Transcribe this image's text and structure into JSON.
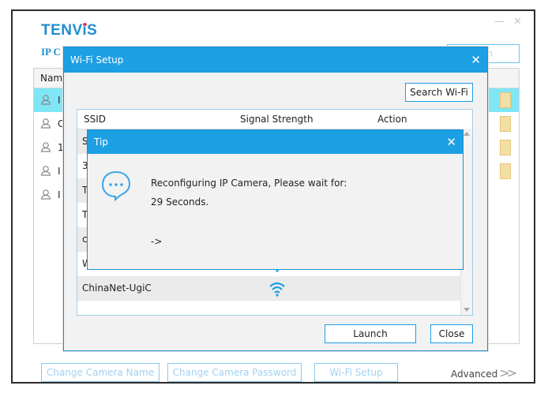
{
  "main_window": {
    "logo": "TENViS",
    "subtitle": "IP C",
    "fresh_label": "sh",
    "minimize_glyph": "—",
    "close_glyph": "✕",
    "list_header": "Nam",
    "rows": [
      {
        "label": "I",
        "selected": true
      },
      {
        "label": "C",
        "selected": false
      },
      {
        "label": "1",
        "selected": false
      },
      {
        "label": "I",
        "selected": false
      },
      {
        "label": "I",
        "selected": false
      }
    ],
    "buttons": {
      "change_name": "Change Camera Name",
      "change_password": "Change Camera Password",
      "wifi_setup": "Wi-Fi Setup",
      "advanced": "Advanced"
    }
  },
  "wifi_dialog": {
    "title": "Wi-Fi Setup",
    "search_button": "Search Wi-Fi",
    "columns": [
      "SSID",
      "Signal Strength",
      "Action"
    ],
    "rows": [
      {
        "ssid": "S",
        "alt": true
      },
      {
        "ssid": "3",
        "alt": false
      },
      {
        "ssid": "T",
        "alt": true
      },
      {
        "ssid": "T",
        "alt": false
      },
      {
        "ssid": "cl",
        "alt": true
      },
      {
        "ssid": "WEISIA",
        "alt": false
      },
      {
        "ssid": "ChinaNet-UgiC",
        "alt": true
      }
    ],
    "launch_button": "Launch",
    "close_button": "Close"
  },
  "tip_dialog": {
    "title": "Tip",
    "message": "Reconfiguring IP Camera, Please wait for:",
    "countdown": "29 Seconds.",
    "progress": "->"
  },
  "colors": {
    "accent": "#1d9fe4",
    "logo": "#1e8fd0",
    "selected_row": "#7fe6f5",
    "tag": "#f3dfa6"
  }
}
